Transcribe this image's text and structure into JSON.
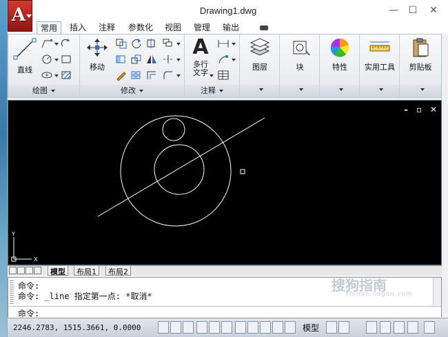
{
  "window": {
    "title": "Drawing1.dwg",
    "app_logo": "A"
  },
  "window_controls": {
    "minimize": "—",
    "maximize": "☐",
    "close": "✕"
  },
  "tabs": [
    {
      "label": "常用",
      "active": true
    },
    {
      "label": "插入"
    },
    {
      "label": "注释"
    },
    {
      "label": "参数化"
    },
    {
      "label": "视图"
    },
    {
      "label": "管理"
    },
    {
      "label": "输出"
    }
  ],
  "ribbon": {
    "draw": {
      "title": "绘图",
      "line_label": "直线"
    },
    "modify": {
      "title": "修改",
      "move_label": "移动"
    },
    "annotation": {
      "title": "注释",
      "mtext_label": "多行\n文字",
      "mtext_letter": "A"
    },
    "layers": {
      "label": "图层"
    },
    "block": {
      "label": "块"
    },
    "properties": {
      "label": "特性"
    },
    "utilities": {
      "label": "实用工具"
    },
    "clipboard": {
      "label": "剪贴板"
    }
  },
  "viewport_controls": {
    "minimize": "–",
    "restore": "▫",
    "close": "✕"
  },
  "ucs": {
    "x": "X",
    "y": "Y"
  },
  "layout_tabs": [
    {
      "label": "模型",
      "active": true
    },
    {
      "label": "布局1"
    },
    {
      "label": "布局2"
    }
  ],
  "command": {
    "history": [
      "命令:",
      "命令: _line 指定第一点: *取消*"
    ],
    "prompt": "命令:"
  },
  "status": {
    "coordinates": "2246.2783, 1515.3661, 0.0000",
    "model_label": "模型"
  },
  "watermark": {
    "text": "搜狗指南",
    "url": "zhinan.sogou.com"
  }
}
